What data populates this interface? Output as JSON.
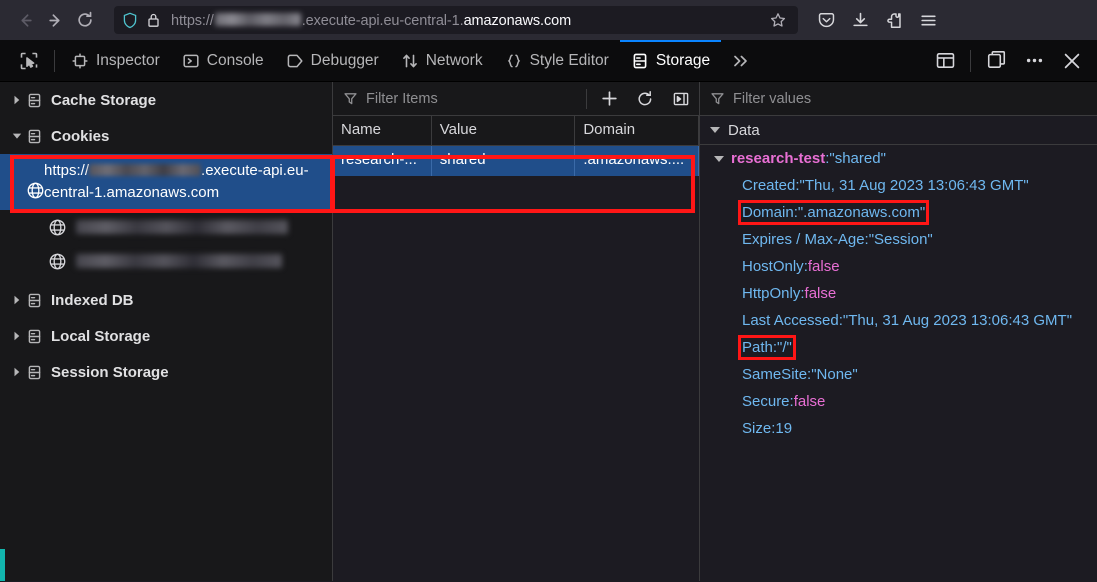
{
  "colors": {
    "accent": "#0a84ff",
    "selection": "#204e8a",
    "annotation": "#ff1616",
    "property_name": "#6fb8f0",
    "property_bool": "#e86fd4",
    "root_key": "#e86fd4",
    "teal_marker": "#12b5ad"
  },
  "browser": {
    "back_icon": "arrow-left-icon",
    "forward_icon": "arrow-right-icon",
    "reload_icon": "reload-icon",
    "shield_icon": "shield-icon",
    "lock_icon": "padlock-icon",
    "url_scheme": "https://",
    "url_redacted": true,
    "url_middle": ".execute-api.eu-central-1.",
    "url_domain": "amazonaws.com",
    "url_full": "https://[redacted].execute-api.eu-central-1.amazonaws.com",
    "bookmark_icon": "star-icon",
    "pocket_icon": "pocket-icon",
    "downloads_icon": "download-icon",
    "extensions_icon": "extensions-icon",
    "menu_icon": "hamburger-menu-icon"
  },
  "devtools": {
    "picker_icon": "element-picker-icon",
    "tabs": [
      {
        "label": "Inspector",
        "icon": "inspector-icon",
        "active": false
      },
      {
        "label": "Console",
        "icon": "console-icon",
        "active": false
      },
      {
        "label": "Debugger",
        "icon": "debugger-icon",
        "active": false
      },
      {
        "label": "Network",
        "icon": "network-icon",
        "active": false
      },
      {
        "label": "Style Editor",
        "icon": "style-editor-icon",
        "active": false
      },
      {
        "label": "Storage",
        "icon": "storage-icon",
        "active": true
      }
    ],
    "overflow_label": "»",
    "overflow_icon": "chevron-double-right-icon",
    "right_icons": [
      "split-console-icon",
      "dock-to-side-icon",
      "devtools-options-icon",
      "close-devtools-icon"
    ]
  },
  "tree": {
    "items": [
      {
        "label": "Cache Storage",
        "expanded": false,
        "icon": "database-icon"
      },
      {
        "label": "Cookies",
        "expanded": true,
        "icon": "database-icon"
      }
    ],
    "cookie_hosts": [
      {
        "scheme": "https://",
        "redacted": true,
        "rest": ".execute-api.eu-central-1.amazonaws.com",
        "full": "https://[redacted].execute-api.eu-central-1.amazonaws.com",
        "selected": true,
        "highlighted": true,
        "icon": "globe-icon"
      },
      {
        "full": "[redacted]",
        "redacted": true,
        "selected": false,
        "icon": "globe-icon"
      },
      {
        "full": "[redacted]",
        "redacted": true,
        "selected": false,
        "icon": "globe-icon"
      }
    ],
    "trailing_items": [
      {
        "label": "Indexed DB",
        "expanded": false,
        "icon": "database-icon"
      },
      {
        "label": "Local Storage",
        "expanded": false,
        "icon": "database-icon"
      },
      {
        "label": "Session Storage",
        "expanded": false,
        "icon": "database-icon"
      }
    ]
  },
  "table": {
    "filter_placeholder": "Filter Items",
    "filter_value": "",
    "filter_icon": "funnel-icon",
    "actions": [
      {
        "name": "add-item-button",
        "icon": "plus-icon"
      },
      {
        "name": "refresh-button",
        "icon": "refresh-icon"
      },
      {
        "name": "toggle-sidebar-button",
        "icon": "toggle-sidebar-icon"
      }
    ],
    "columns": [
      "Name",
      "Value",
      "Domain"
    ],
    "rows": [
      {
        "name": "research-...",
        "value": "shared",
        "domain": ".amazonaws....",
        "selected": true,
        "highlighted": true
      }
    ]
  },
  "detail": {
    "filter_placeholder": "Filter values",
    "filter_value": "",
    "filter_icon": "funnel-icon",
    "section_label": "Data",
    "section_expanded": true,
    "root": {
      "key": "research-test",
      "value": "\"shared\"",
      "expanded": true
    },
    "properties": [
      {
        "key": "Created",
        "value": "\"Thu, 31 Aug 2023 13:06:43 GMT\"",
        "kind": "string",
        "highlighted": false
      },
      {
        "key": "Domain",
        "value": "\".amazonaws.com\"",
        "kind": "string",
        "highlighted": true
      },
      {
        "key": "Expires / Max-Age",
        "value": "\"Session\"",
        "kind": "string",
        "highlighted": false
      },
      {
        "key": "HostOnly",
        "value": "false",
        "kind": "bool",
        "highlighted": false
      },
      {
        "key": "HttpOnly",
        "value": "false",
        "kind": "bool",
        "highlighted": false
      },
      {
        "key": "Last Accessed",
        "value": "\"Thu, 31 Aug 2023 13:06:43 GMT\"",
        "kind": "string",
        "highlighted": false
      },
      {
        "key": "Path",
        "value": "\"/\"",
        "kind": "string",
        "highlighted": true
      },
      {
        "key": "SameSite",
        "value": "\"None\"",
        "kind": "string",
        "highlighted": false
      },
      {
        "key": "Secure",
        "value": "false",
        "kind": "bool",
        "highlighted": false
      },
      {
        "key": "Size",
        "value": "19",
        "kind": "number",
        "highlighted": false
      }
    ]
  }
}
